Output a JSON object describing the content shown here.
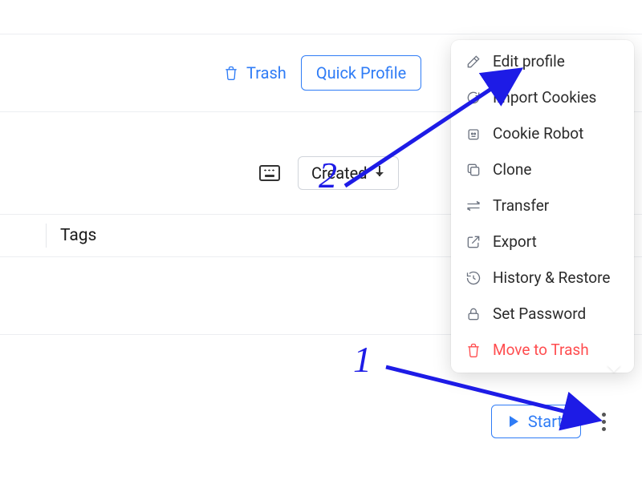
{
  "toolbar": {
    "trash_label": "Trash",
    "quick_profile_label": "Quick Profile"
  },
  "filterbar": {
    "sort_label": "Created"
  },
  "table": {
    "header_tags": "Tags"
  },
  "profile_actions": {
    "start_label": "Start"
  },
  "context_menu": {
    "items": [
      {
        "label": "Edit profile"
      },
      {
        "label": "Import Cookies"
      },
      {
        "label": "Cookie Robot"
      },
      {
        "label": "Clone"
      },
      {
        "label": "Transfer"
      },
      {
        "label": "Export"
      },
      {
        "label": "History & Restore"
      },
      {
        "label": "Set Password"
      },
      {
        "label": "Move to Trash"
      }
    ]
  },
  "annotations": {
    "step1": "1",
    "step2": "2",
    "color": "#1d1be6"
  }
}
